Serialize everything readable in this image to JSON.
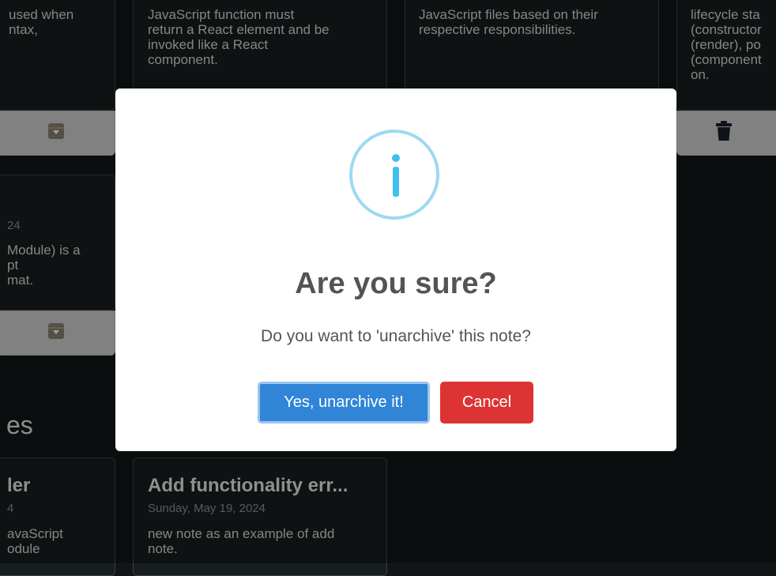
{
  "background": {
    "top_cards": [
      {
        "text": "used when\nntax,"
      },
      {
        "text": "JavaScript function must\nreturn a React element and be\ninvoked like a React\ncomponent."
      },
      {
        "text": "JavaScript files based on their\nrespective responsibilities."
      },
      {
        "text": "lifecycle sta\n(constructor\n(render), po\n(component\non."
      }
    ],
    "left_card": {
      "date_fragment": "24",
      "text": "Module) is a\npt\nmat."
    },
    "section_heading": "es",
    "bottom_cards": [
      {
        "title": "ler",
        "date_fragment": "4",
        "text": "avaScript\nodule"
      },
      {
        "title": "Add functionality err...",
        "date": "Sunday, May 19, 2024",
        "text": "new note as an example of add\nnote."
      }
    ],
    "icons": {
      "unarchive": "archive-down-icon",
      "delete": "trash-icon"
    }
  },
  "modal": {
    "icon": "info-icon",
    "title": "Are you sure?",
    "text": "Do you want to 'unarchive' this note?",
    "confirm_label": "Yes, unarchive it!",
    "cancel_label": "Cancel",
    "colors": {
      "confirm": "#3085d6",
      "cancel": "#dd3333",
      "info": "#3fc0ee"
    }
  }
}
